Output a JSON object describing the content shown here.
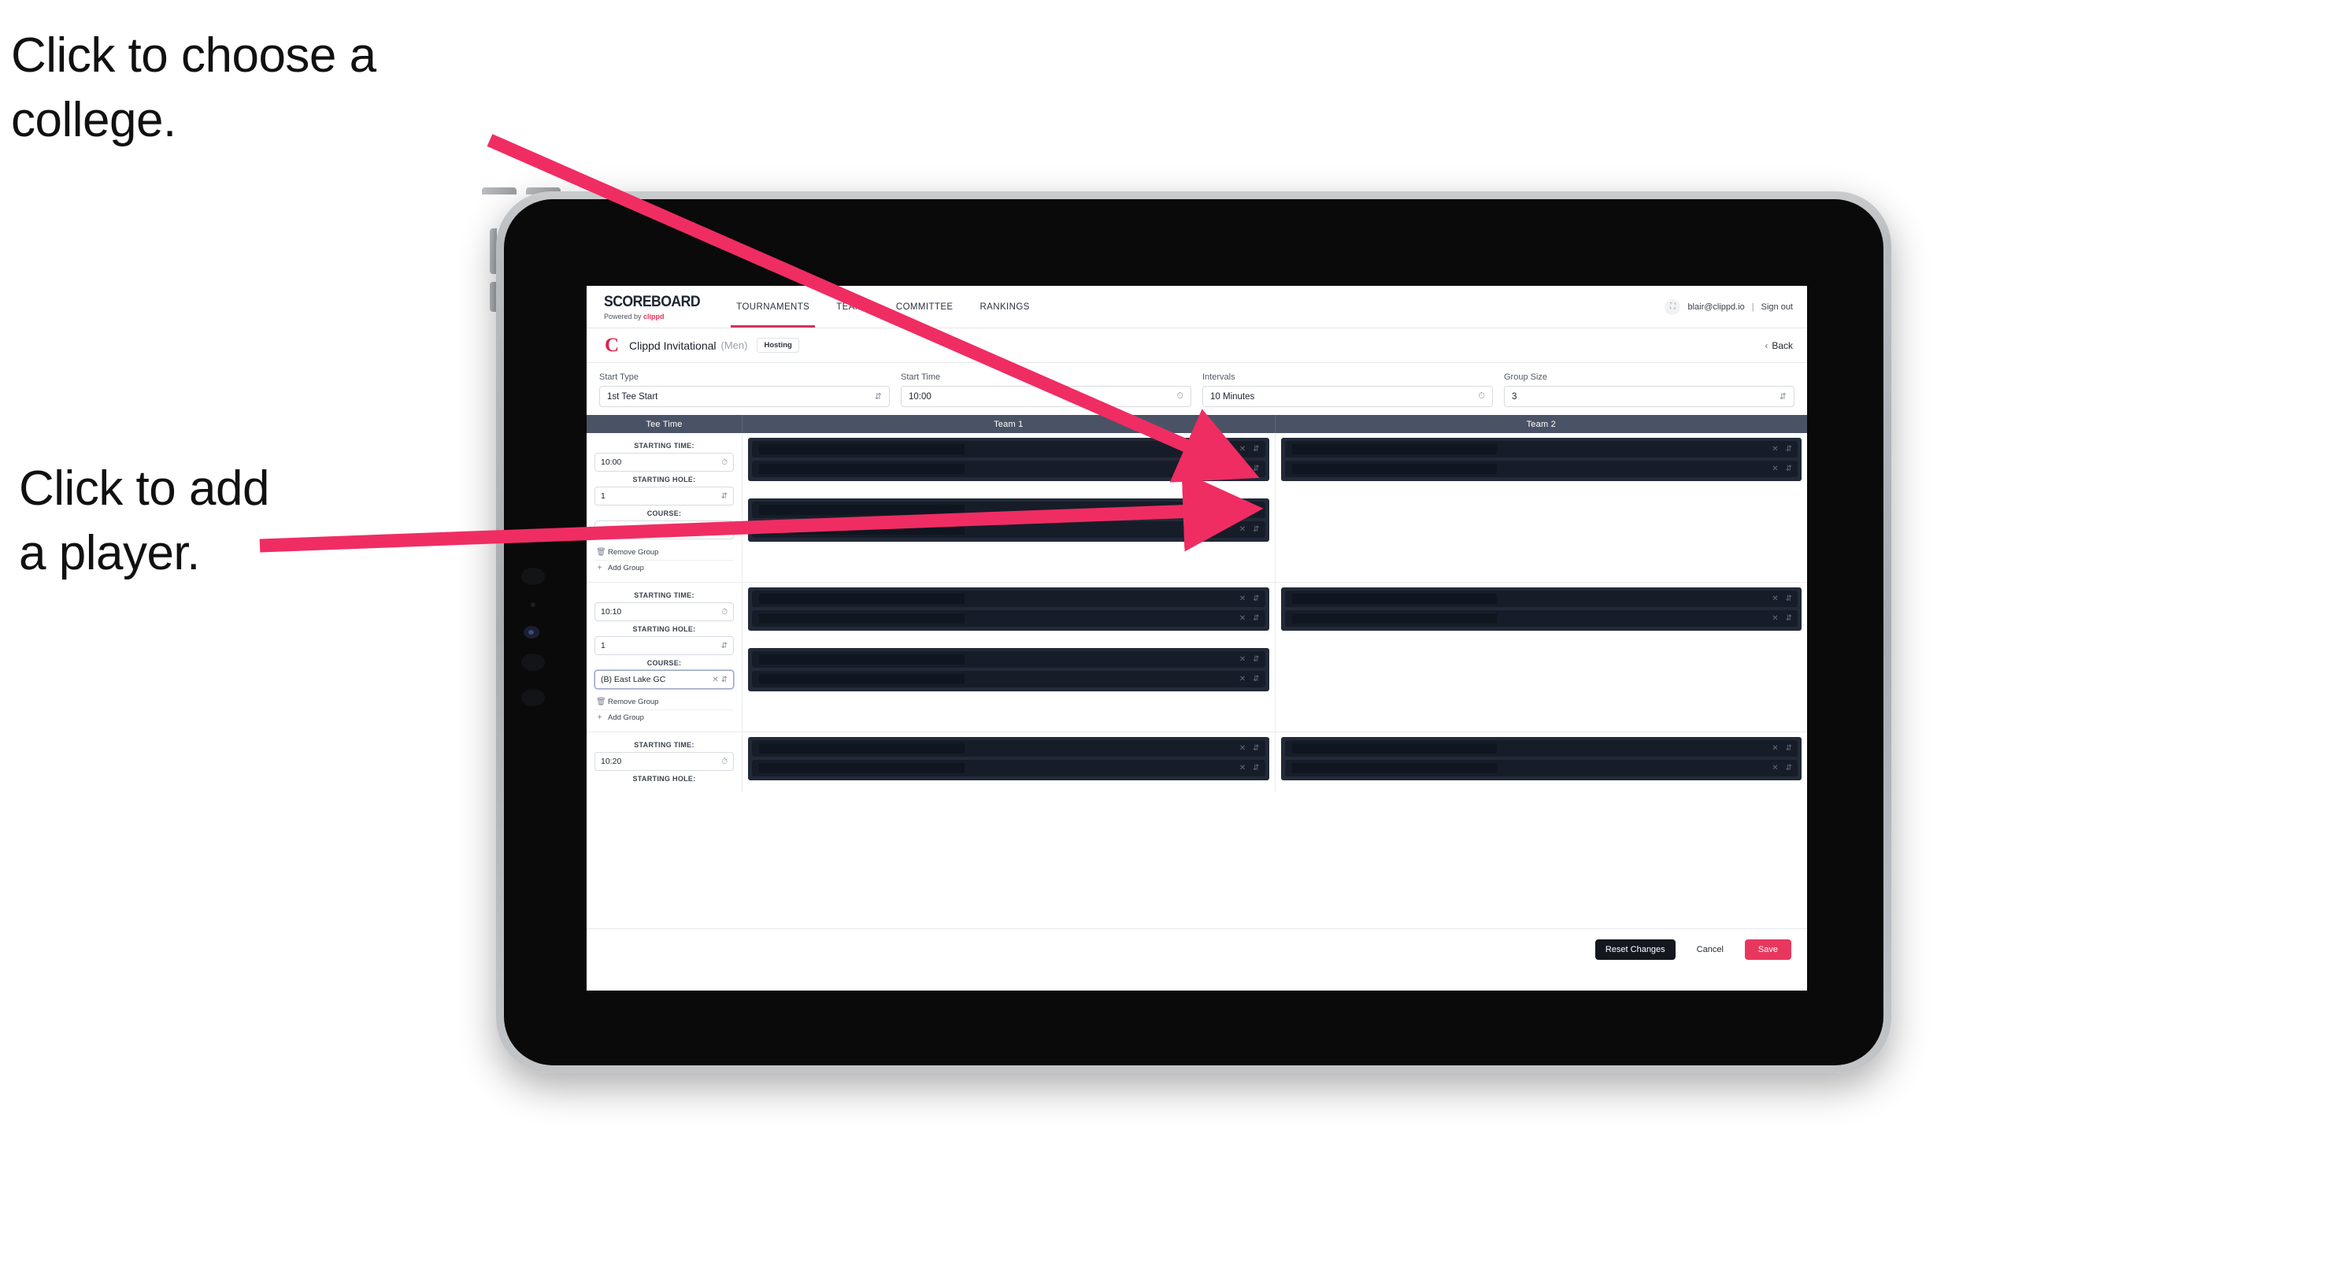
{
  "annotations": {
    "choose_college": "Click to choose a\ncollege.",
    "add_player": "Click to add\na player."
  },
  "colors": {
    "accent_pink": "#e8375f",
    "annotation_arrow": "#ef2d63",
    "table_header": "#4a5365",
    "redact_dark": "#222a38"
  },
  "topnav": {
    "brand_word": "SCOREBOARD",
    "brand_sub_prefix": "Powered by ",
    "brand_sub_name": "clippd",
    "links": [
      {
        "label": "TOURNAMENTS",
        "active": true
      },
      {
        "label": "TEAMS",
        "active": false
      },
      {
        "label": "COMMITTEE",
        "active": false
      },
      {
        "label": "RANKINGS",
        "active": false
      }
    ],
    "account_icon": "user-badge-icon",
    "account_email": "blair@clippd.io",
    "separator": "|",
    "sign_out": "Sign out"
  },
  "tournament": {
    "logo_letter": "C",
    "name": "Clippd Invitational",
    "gender": "(Men)",
    "status_pill": "Hosting",
    "back_label": "Back",
    "back_icon": "chevron-left-icon"
  },
  "settings": {
    "fields": [
      {
        "label": "Start Type",
        "value": "1st Tee Start",
        "icon": "stepper-icon"
      },
      {
        "label": "Start Time",
        "value": "10:00",
        "icon": "clock-icon"
      },
      {
        "label": "Intervals",
        "value": "10 Minutes",
        "icon": "clock-icon"
      },
      {
        "label": "Group Size",
        "value": "3",
        "icon": "stepper-icon"
      }
    ]
  },
  "table": {
    "headers": [
      "Tee Time",
      "Team 1",
      "Team 2"
    ],
    "labels": {
      "starting_time": "STARTING TIME:",
      "starting_hole": "STARTING HOLE:",
      "course": "COURSE:",
      "remove_group": "Remove Group",
      "add_group": "Add Group"
    },
    "groups": [
      {
        "starting_time": "10:00",
        "starting_hole": "1",
        "course": "(A) Peachtree GC",
        "course_focused": false,
        "team1_blocks": [
          2,
          2
        ],
        "team2_blocks": [
          2
        ]
      },
      {
        "starting_time": "10:10",
        "starting_hole": "1",
        "course": "(B) East Lake GC",
        "course_focused": true,
        "team1_blocks": [
          2,
          2
        ],
        "team2_blocks": [
          2
        ]
      },
      {
        "starting_time": "10:20",
        "starting_hole": "",
        "course": "",
        "course_focused": false,
        "team1_blocks": [
          2
        ],
        "team2_blocks": [
          2
        ]
      }
    ]
  },
  "footer": {
    "reset_label": "Reset Changes",
    "cancel_label": "Cancel",
    "save_label": "Save"
  }
}
